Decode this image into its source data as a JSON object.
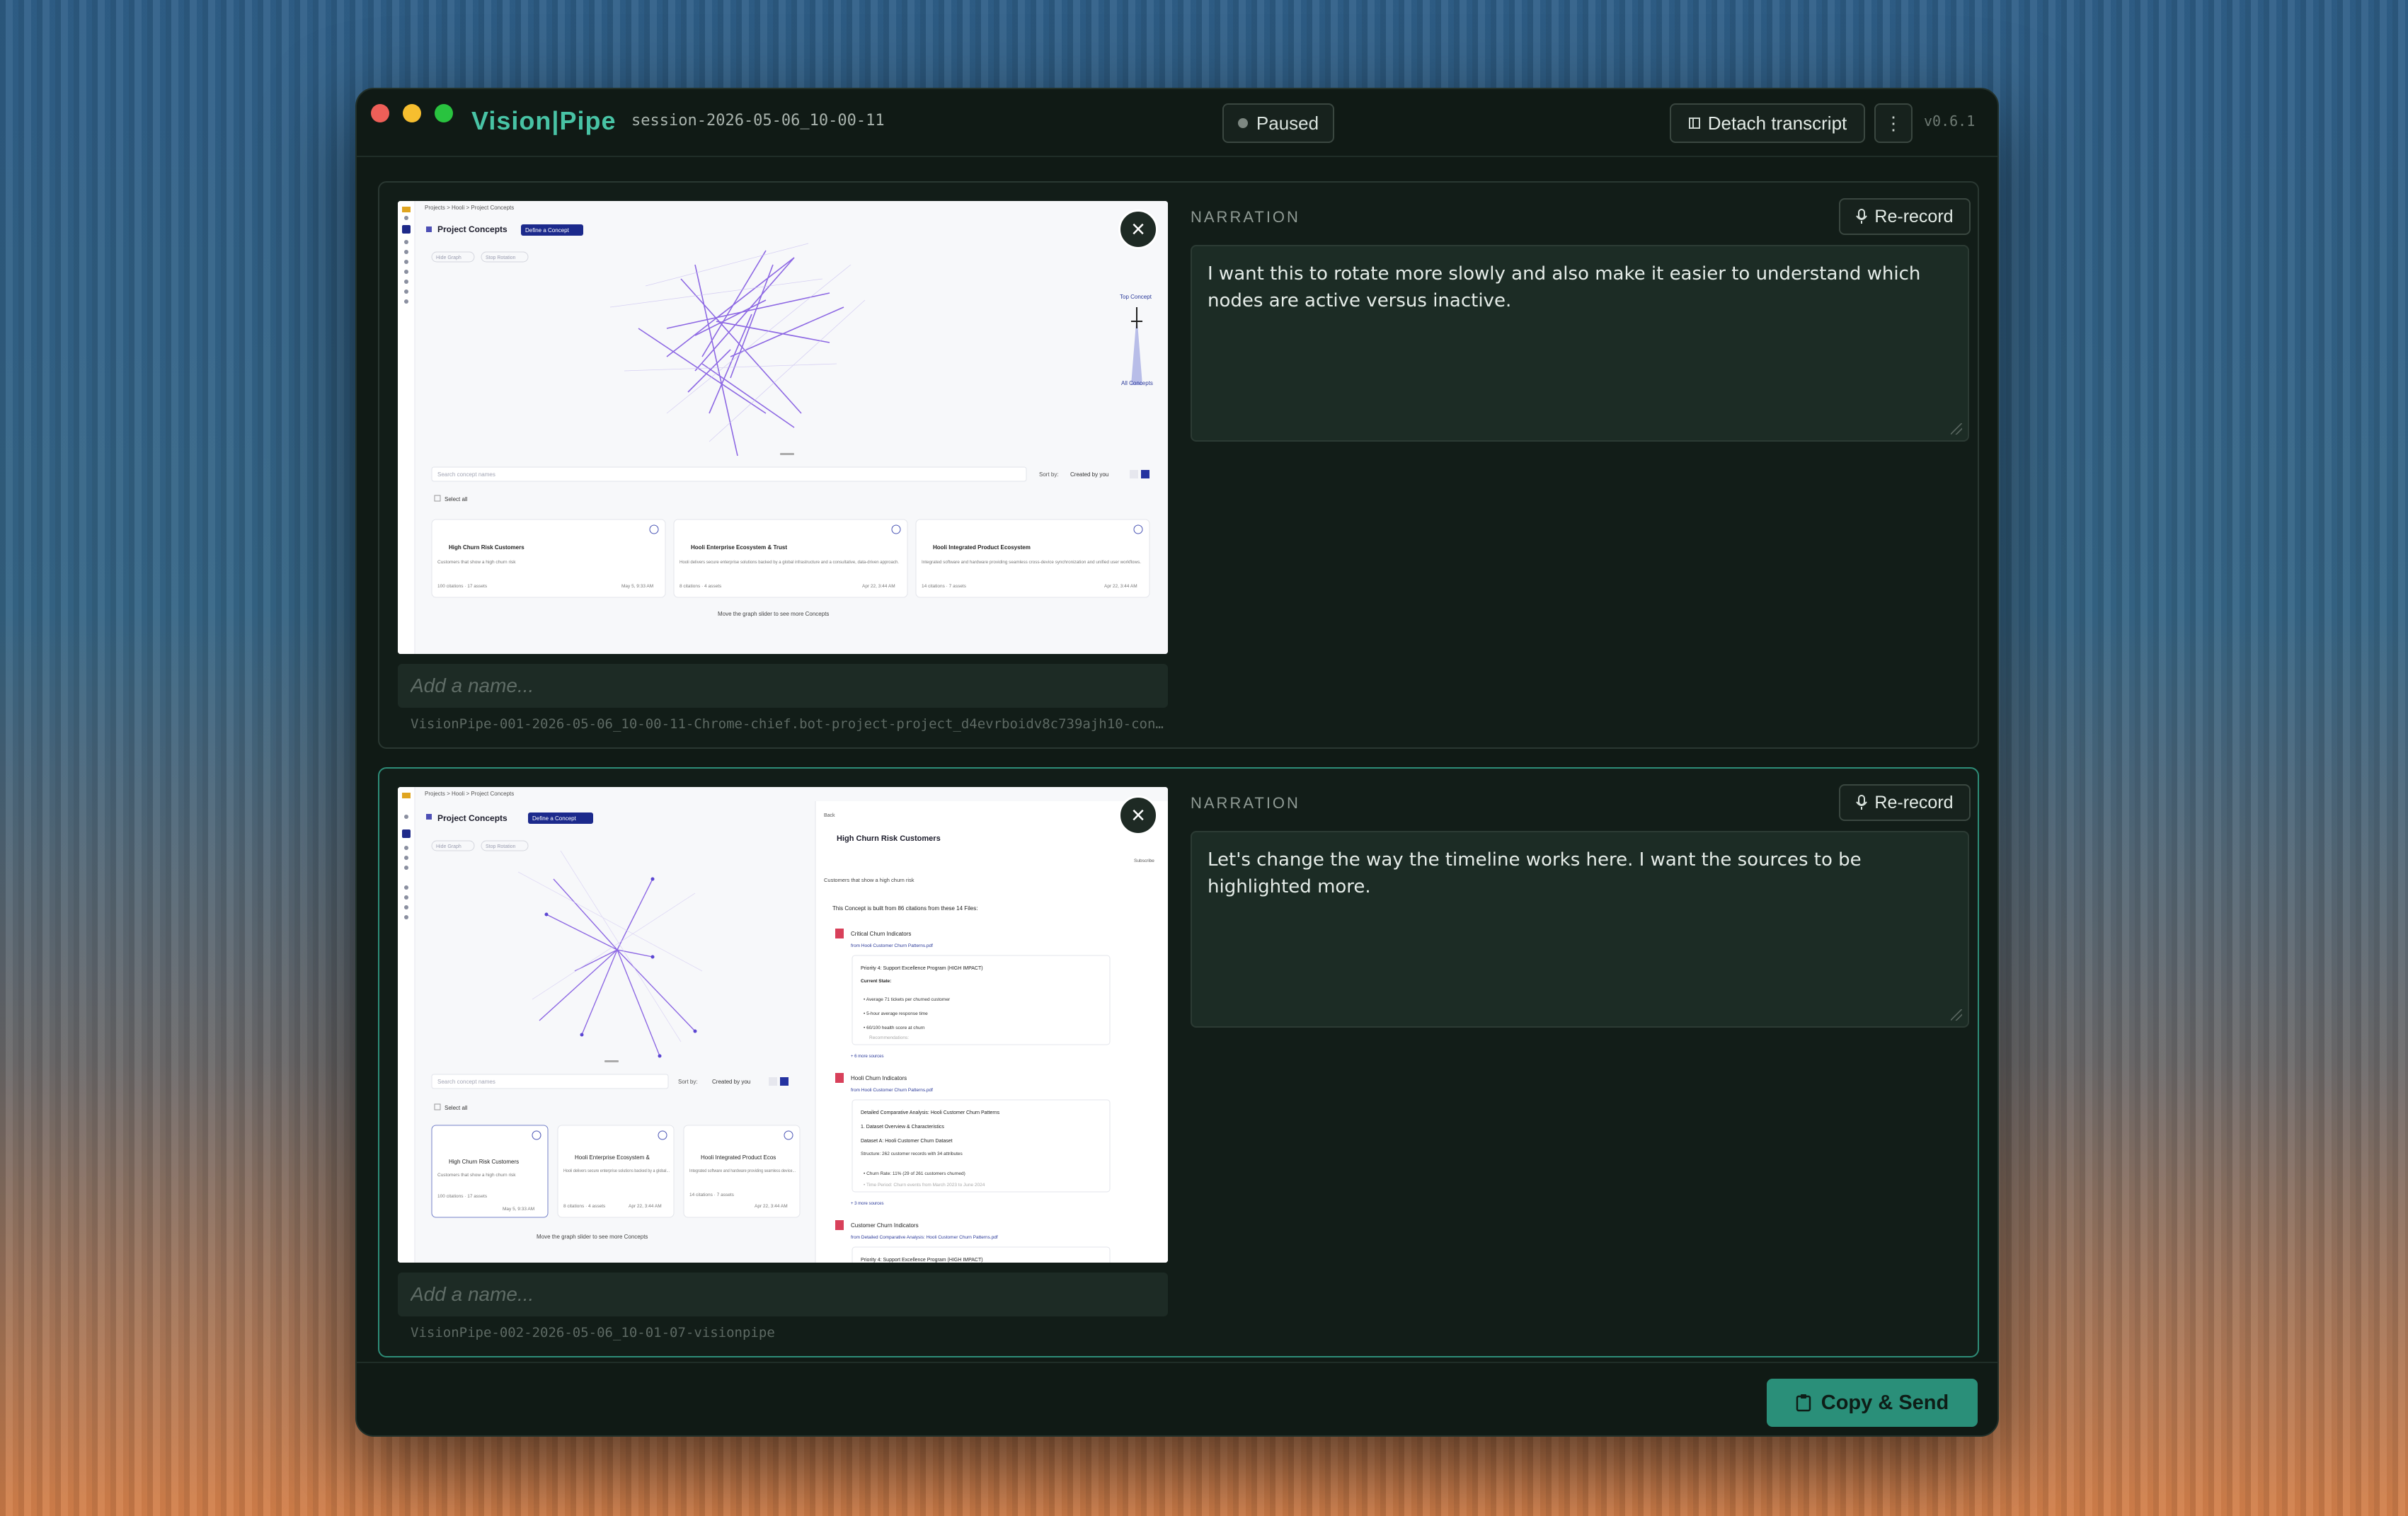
{
  "app": {
    "brand": "Vision|Pipe",
    "session": "session-2026-05-06_10-00-11",
    "status": "Paused",
    "detach_label": "Detach transcript",
    "menu_glyph": "⋮",
    "version": "v0.6.1"
  },
  "captures": [
    {
      "name_placeholder": "Add a name...",
      "filename": "VisionPipe-001-2026-05-06_10-00-11-Chrome-chief.bot-project-project_d4evrboidv8c739ajh10-concep…",
      "narration_label": "NARRATION",
      "rerecord_label": "Re-record",
      "narration": "I want this to rotate more slowly and also make it easier to understand which nodes are active versus inactive.",
      "thumb": {
        "breadcrumb": "Projects  >  Hooli  >  Project Concepts",
        "title": "Project Concepts",
        "define_btn": "Define a Concept",
        "hide_graph": "Hide Graph",
        "stop_rotation": "Stop Rotation",
        "top_concept": "Top Concept",
        "all_concepts": "All Concepts",
        "search_placeholder": "Search concept names",
        "sort_by": "Sort by:",
        "sort_value": "Created by you",
        "select_all": "Select all",
        "cards": [
          {
            "title": "High Churn Risk Customers",
            "desc": "Customers that show a high churn risk",
            "meta": "100 citations · 17 assets",
            "date": "May 5, 9:33 AM"
          },
          {
            "title": "Hooli Enterprise Ecosystem & Trust",
            "desc": "Hooli delivers secure enterprise solutions backed by a global infrastructure and a consultative, data-driven approach.",
            "meta": "8 citations · 4 assets",
            "date": "Apr 22, 3:44 AM"
          },
          {
            "title": "Hooli Integrated Product Ecosystem",
            "desc": "Integrated software and hardware providing seamless cross-device synchronization and unified user workflows.",
            "meta": "14 citations · 7 assets",
            "date": "Apr 22, 3:44 AM"
          }
        ],
        "slider_hint": "Move the graph slider to see more Concepts"
      }
    },
    {
      "name_placeholder": "Add a name...",
      "filename": "VisionPipe-002-2026-05-06_10-01-07-visionpipe",
      "narration_label": "NARRATION",
      "rerecord_label": "Re-record",
      "narration": "Let's change the way the timeline works here. I want the sources to be highlighted more.",
      "thumb": {
        "breadcrumb": "Projects  >  Hooli  >  Project Concepts",
        "title": "Project Concepts",
        "define_btn": "Define a Concept",
        "hide_graph": "Hide Graph",
        "stop_rotation": "Stop Rotation",
        "search_placeholder": "Search concept names",
        "sort_by": "Sort by:",
        "sort_value": "Created by you",
        "select_all": "Select all",
        "cards": [
          {
            "title": "High Churn Risk Customers",
            "desc": "Customers that show a high churn risk",
            "meta": "100 citations · 17 assets",
            "date": "May 5, 9:33 AM"
          },
          {
            "title": "Hooli Enterprise Ecosystem &",
            "desc": "Hooli delivers secure enterprise solutions backed by a global...",
            "meta": "8 citations · 4 assets",
            "date": "Apr 22, 3:44 AM"
          },
          {
            "title": "Hooli Integrated Product Ecos",
            "desc": "Integrated software and hardware providing seamless device...",
            "meta": "14 citations · 7 assets",
            "date": "Apr 22, 3:44 AM"
          }
        ],
        "slider_hint": "Move the graph slider to see more Concepts",
        "panel": {
          "back": "Back",
          "title": "High Churn Risk Customers",
          "subscribe": "Subscribe",
          "desc": "Customers that show a high churn risk",
          "built_from": "This Concept is built from 86 citations from these 14 Files:",
          "sources": [
            {
              "title": "Critical Churn Indicators",
              "from": "from Hooli Customer Churn Patterns.pdf",
              "box": [
                "Priority 4: Support Excellence Program (HIGH IMPACT)",
                "Current State:",
                "• Average 71 tickets per churned customer",
                "• 5-hour average response time",
                "• 60/100 health score at churn",
                "Recommendations:"
              ],
              "more": "+ 6 more sources"
            },
            {
              "title": "Hooli Churn Indicators",
              "from": "from Hooli Customer Churn Patterns.pdf",
              "box": [
                "Detailed Comparative Analysis: Hooli Customer Churn Patterns",
                "1. Dataset Overview & Characteristics",
                "Dataset A: Hooli Customer Churn Dataset",
                "Structure: 262 customer records with 34 attributes",
                "• Churn Rate: 11% (29 of 261 customers churned)",
                "• Time Period: Churn events from March 2023 to June 2024"
              ],
              "more": "+ 3 more sources"
            },
            {
              "title": "Customer Churn Indicators",
              "from": "from Detailed Comparative Analysis: Hooli Customer Churn Patterns.pdf",
              "box": [
                "Priority 4: Support Excellence Program (HIGH IMPACT)"
              ],
              "more": ""
            }
          ]
        }
      }
    }
  ],
  "footer": {
    "send_label": "Copy & Send"
  }
}
